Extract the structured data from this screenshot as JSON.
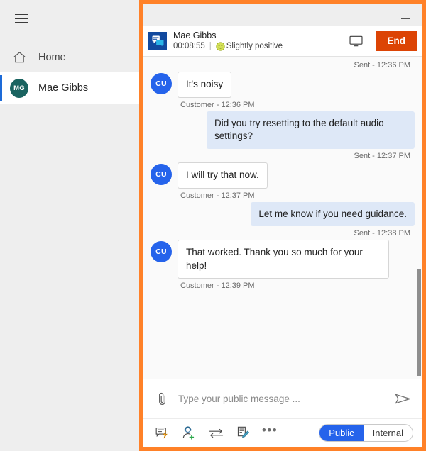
{
  "sidebar": {
    "menu_icon": "hamburger-icon",
    "items": [
      {
        "label": "Home",
        "icon": "home-icon"
      },
      {
        "label": "Mae Gibbs",
        "icon": "avatar",
        "initials": "MG",
        "active": true
      }
    ]
  },
  "titlebar": {
    "minimize_label": "Minimize"
  },
  "header": {
    "icon": "conversation-icon",
    "name": "Mae Gibbs",
    "duration": "00:08:55",
    "separator": "|",
    "sentiment_emoji": "🙂",
    "sentiment": "Slightly positive",
    "screen_share_icon": "monitor-icon",
    "end_label": "End"
  },
  "transcript": {
    "entries": [
      {
        "type": "meta",
        "align": "right",
        "text": "Sent - 12:36 PM"
      },
      {
        "type": "message",
        "side": "customer",
        "initials": "CU",
        "text": "It's noisy"
      },
      {
        "type": "meta",
        "align": "left",
        "text": "Customer - 12:36 PM"
      },
      {
        "type": "message",
        "side": "agent",
        "text": "Did you try resetting to the default audio settings?"
      },
      {
        "type": "meta",
        "align": "right",
        "text": "Sent - 12:37 PM"
      },
      {
        "type": "message",
        "side": "customer",
        "initials": "CU",
        "text": "I will try that now."
      },
      {
        "type": "meta",
        "align": "left",
        "text": "Customer - 12:37 PM"
      },
      {
        "type": "message",
        "side": "agent",
        "text": "Let me know if you need guidance."
      },
      {
        "type": "meta",
        "align": "right",
        "text": "Sent - 12:38 PM"
      },
      {
        "type": "message",
        "side": "customer",
        "initials": "CU",
        "text": "That worked. Thank you so much for your help!"
      },
      {
        "type": "meta",
        "align": "left",
        "text": "Customer - 12:39 PM"
      }
    ]
  },
  "composer": {
    "attach_icon": "paperclip-icon",
    "placeholder": "Type your public message ...",
    "value": "",
    "send_icon": "send-icon"
  },
  "toolbar": {
    "tools": [
      {
        "name": "quick-reply-icon",
        "label": "Quick reply"
      },
      {
        "name": "add-agent-icon",
        "label": "Add agent"
      },
      {
        "name": "transfer-icon",
        "label": "Transfer"
      },
      {
        "name": "notes-icon",
        "label": "Notes"
      },
      {
        "name": "more-options-icon",
        "label": "More"
      }
    ],
    "mode_toggle": {
      "selected": "Public",
      "options": [
        "Public",
        "Internal"
      ]
    }
  },
  "colors": {
    "highlight_border": "#ff8128",
    "end_button": "#dc4405",
    "accent_blue": "#2563eb",
    "agent_bubble": "#dee8f7",
    "avatar_teal": "#1a6360",
    "conv_icon_blue": "#11499e"
  }
}
